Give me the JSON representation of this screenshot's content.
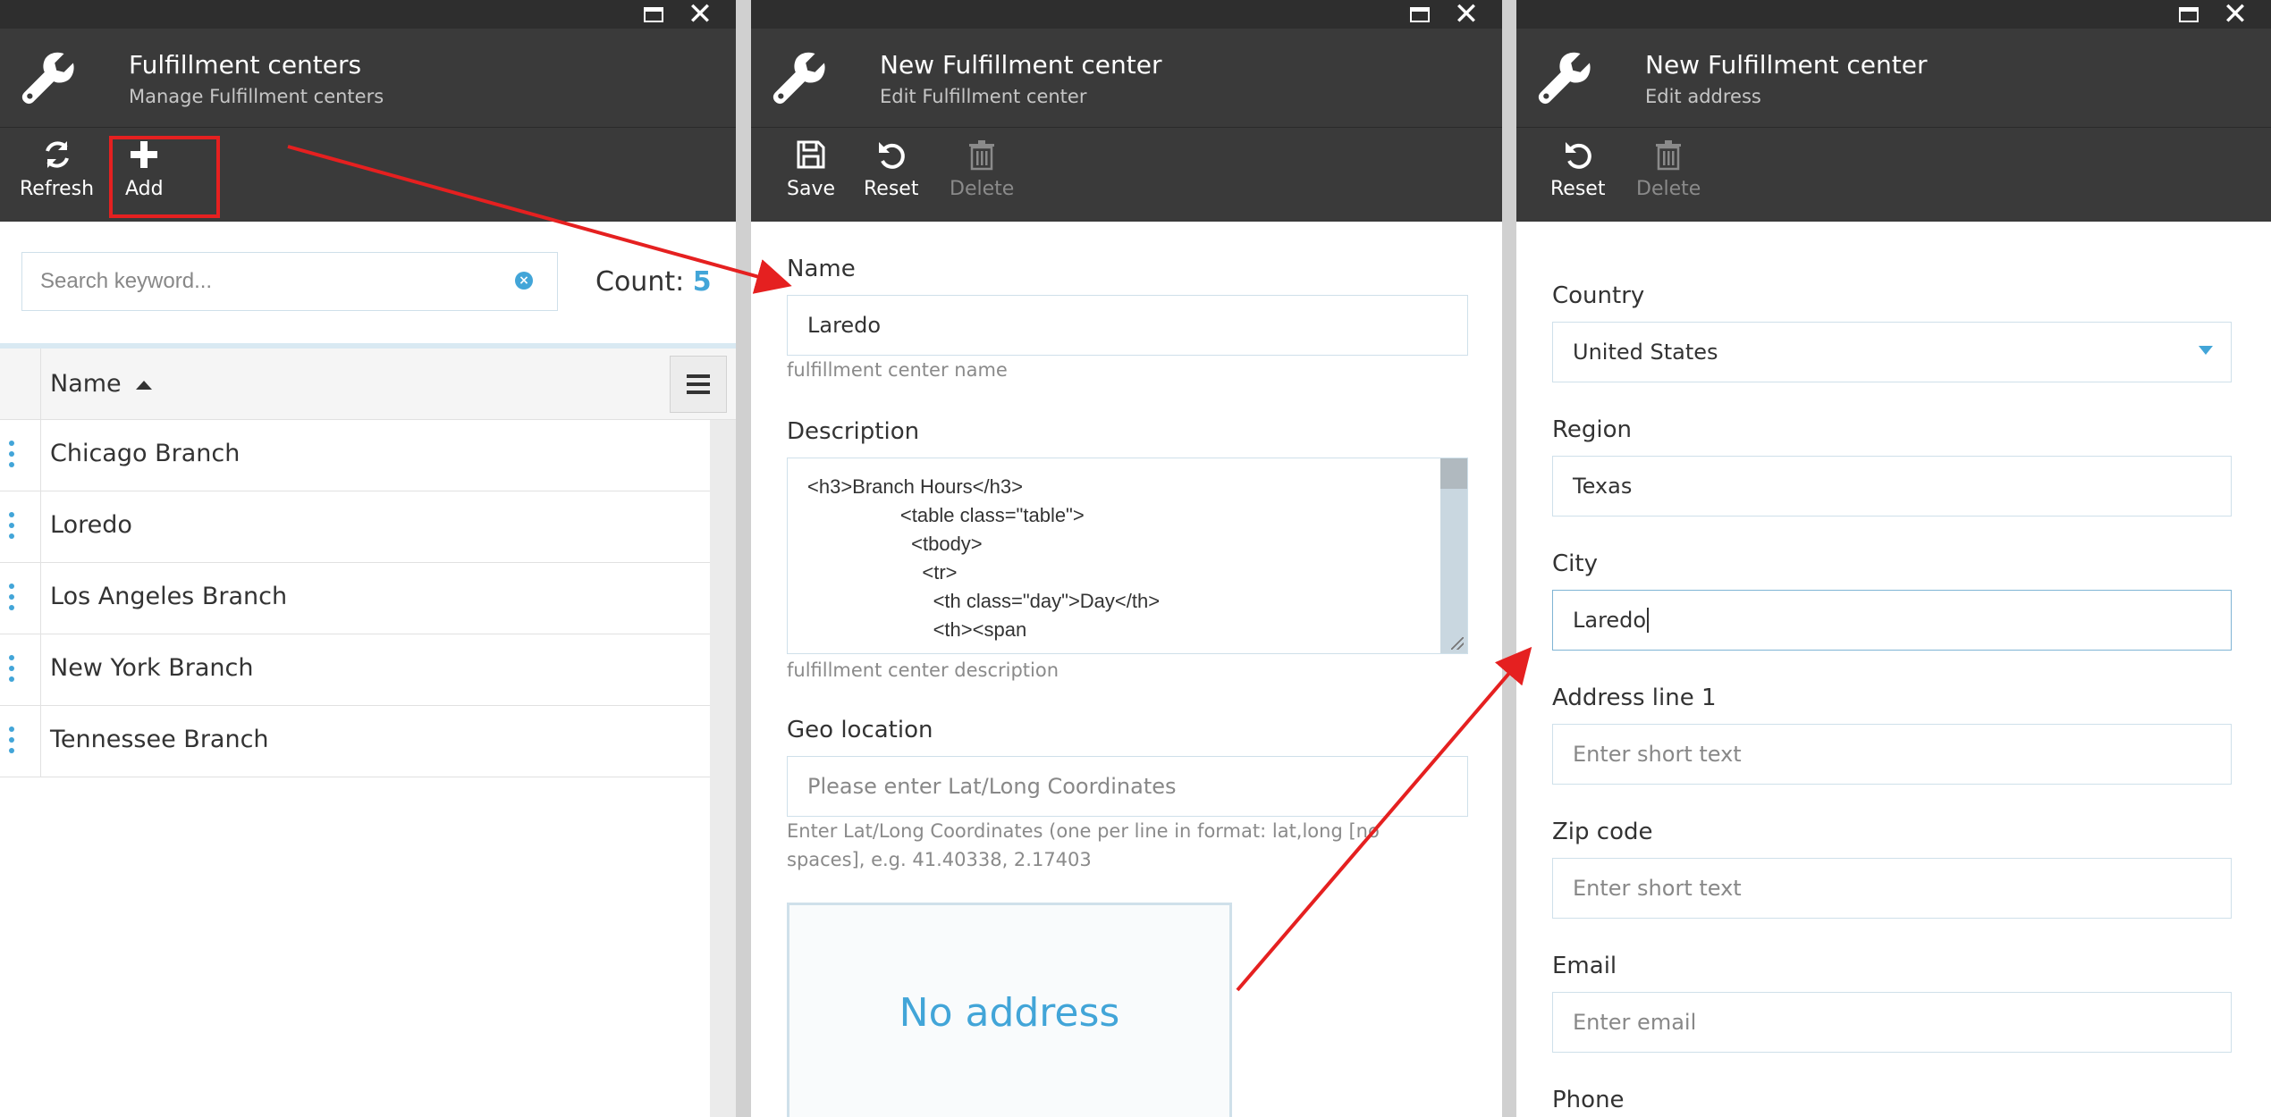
{
  "blade1": {
    "title": "Fulfillment centers",
    "subtitle": "Manage Fulfillment centers",
    "toolbar": {
      "refresh_label": "Refresh",
      "add_label": "Add"
    },
    "search": {
      "placeholder": "Search keyword..."
    },
    "count_label": "Count:",
    "count_value": "5",
    "grid": {
      "column_name": "Name",
      "rows": [
        "Chicago Branch",
        "Loredo",
        "Los Angeles Branch",
        "New York Branch",
        "Tennessee Branch"
      ]
    }
  },
  "blade2": {
    "title": "New Fulfillment center",
    "subtitle": "Edit Fulfillment center",
    "toolbar": {
      "save_label": "Save",
      "reset_label": "Reset",
      "delete_label": "Delete"
    },
    "name": {
      "label": "Name",
      "value": "Laredo",
      "hint": "fulfillment center name"
    },
    "description": {
      "label": "Description",
      "value": "<h3>Branch Hours</h3>\n                 <table class=\"table\">\n                   <tbody>\n                     <tr>\n                       <th class=\"day\">Day</th>\n                       <th><span",
      "hint": "fulfillment center description"
    },
    "geo": {
      "label": "Geo location",
      "placeholder": "Please enter Lat/Long Coordinates",
      "hint_line1": "Enter Lat/Long Coordinates (one per line in format: lat,long [no",
      "hint_line2": "spaces], e.g. 41.40338, 2.17403"
    },
    "no_address": "No address"
  },
  "blade3": {
    "title": "New Fulfillment center",
    "subtitle": "Edit address",
    "toolbar": {
      "reset_label": "Reset",
      "delete_label": "Delete"
    },
    "country": {
      "label": "Country",
      "value": "United States"
    },
    "region": {
      "label": "Region",
      "value": "Texas"
    },
    "city": {
      "label": "City",
      "value": "Laredo"
    },
    "address1": {
      "label": "Address line 1",
      "placeholder": "Enter short text"
    },
    "zip": {
      "label": "Zip code",
      "placeholder": "Enter short text"
    },
    "email": {
      "label": "Email",
      "placeholder": "Enter email"
    },
    "phone": {
      "label": "Phone"
    }
  },
  "colors": {
    "accent": "#42a5d8",
    "header_bg": "#3a3a3a",
    "annotation": "#e52020"
  },
  "icons": {
    "blade_header": "wrench-icon",
    "refresh": "refresh-icon",
    "add": "plus-icon",
    "save": "save-icon",
    "reset": "undo-icon",
    "delete": "trash-icon"
  }
}
